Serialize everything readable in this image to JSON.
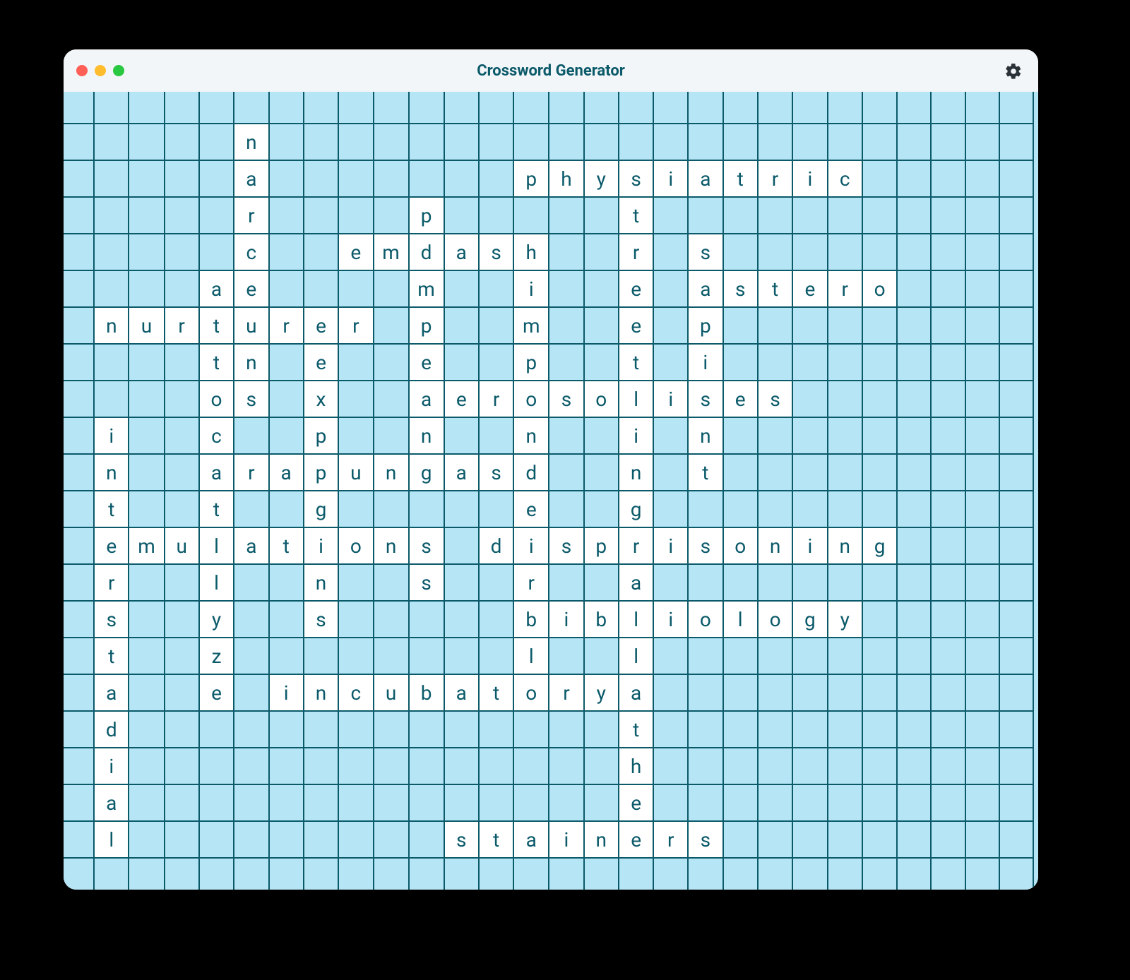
{
  "app": {
    "title": "Crossword Generator"
  },
  "grid": {
    "cols": 28,
    "rows": 23,
    "filled": {
      "1": {
        "5": "n"
      },
      "2": {
        "5": "a",
        "13": "p",
        "14": "h",
        "15": "y",
        "16": "s",
        "17": "i",
        "18": "a",
        "19": "t",
        "20": "r",
        "21": "i",
        "22": "c"
      },
      "3": {
        "5": "r",
        "10": "p",
        "16": "t"
      },
      "4": {
        "5": "c",
        "8": "e",
        "9": "m",
        "10": "d",
        "11": "a",
        "12": "s",
        "13": "h",
        "16": "r",
        "18": "s"
      },
      "5": {
        "4": "a",
        "5": "e",
        "10": "m",
        "13": "i",
        "16": "e",
        "18": "a",
        "19": "s",
        "20": "t",
        "21": "e",
        "22": "r",
        "23": "o"
      },
      "6": {
        "1": "n",
        "2": "u",
        "3": "r",
        "4": "t",
        "5": "u",
        "6": "r",
        "7": "e",
        "8": "r",
        "10": "p",
        "13": "m",
        "16": "e",
        "18": "p"
      },
      "7": {
        "4": "t",
        "5": "n",
        "7": "e",
        "10": "e",
        "13": "p",
        "16": "t",
        "18": "i"
      },
      "8": {
        "4": "o",
        "5": "s",
        "7": "x",
        "10": "a",
        "11": "e",
        "12": "r",
        "13": "o",
        "14": "s",
        "15": "o",
        "16": "l",
        "17": "i",
        "18": "s",
        "19": "e",
        "20": "s"
      },
      "9": {
        "1": "i",
        "4": "c",
        "7": "p",
        "10": "n",
        "13": "n",
        "16": "i",
        "18": "n"
      },
      "10": {
        "1": "n",
        "4": "a",
        "5": "r",
        "6": "a",
        "7": "p",
        "8": "u",
        "9": "n",
        "10": "g",
        "11": "a",
        "12": "s",
        "13": "d",
        "16": "n",
        "18": "t"
      },
      "11": {
        "1": "t",
        "4": "t",
        "7": "g",
        "13": "e",
        "16": "g"
      },
      "12": {
        "1": "e",
        "2": "m",
        "3": "u",
        "4": "l",
        "5": "a",
        "6": "t",
        "7": "i",
        "8": "o",
        "9": "n",
        "10": "s",
        "12": "d",
        "13": "i",
        "14": "s",
        "15": "p",
        "16": "r",
        "17": "i",
        "18": "s",
        "19": "o",
        "20": "n",
        "21": "i",
        "22": "n",
        "23": "g"
      },
      "13": {
        "1": "r",
        "4": "l",
        "7": "n",
        "10": "s",
        "13": "r",
        "16": "a"
      },
      "14": {
        "1": "s",
        "4": "y",
        "7": "s",
        "13": "b",
        "14": "i",
        "15": "b",
        "16": "l",
        "17": "i",
        "18": "o",
        "19": "l",
        "20": "o",
        "21": "g",
        "22": "y"
      },
      "15": {
        "1": "t",
        "4": "z",
        "13": "l",
        "16": "l"
      },
      "16": {
        "1": "a",
        "4": "e",
        "6": "i",
        "7": "n",
        "8": "c",
        "9": "u",
        "10": "b",
        "11": "a",
        "12": "t",
        "13": "o",
        "14": "r",
        "15": "y",
        "16": "a"
      },
      "17": {
        "1": "d",
        "16": "t"
      },
      "18": {
        "1": "i",
        "16": "h"
      },
      "19": {
        "1": "a",
        "16": "e"
      },
      "20": {
        "1": "l",
        "11": "s",
        "12": "t",
        "13": "a",
        "14": "i",
        "15": "n",
        "16": "e",
        "17": "r",
        "18": "s"
      }
    }
  }
}
